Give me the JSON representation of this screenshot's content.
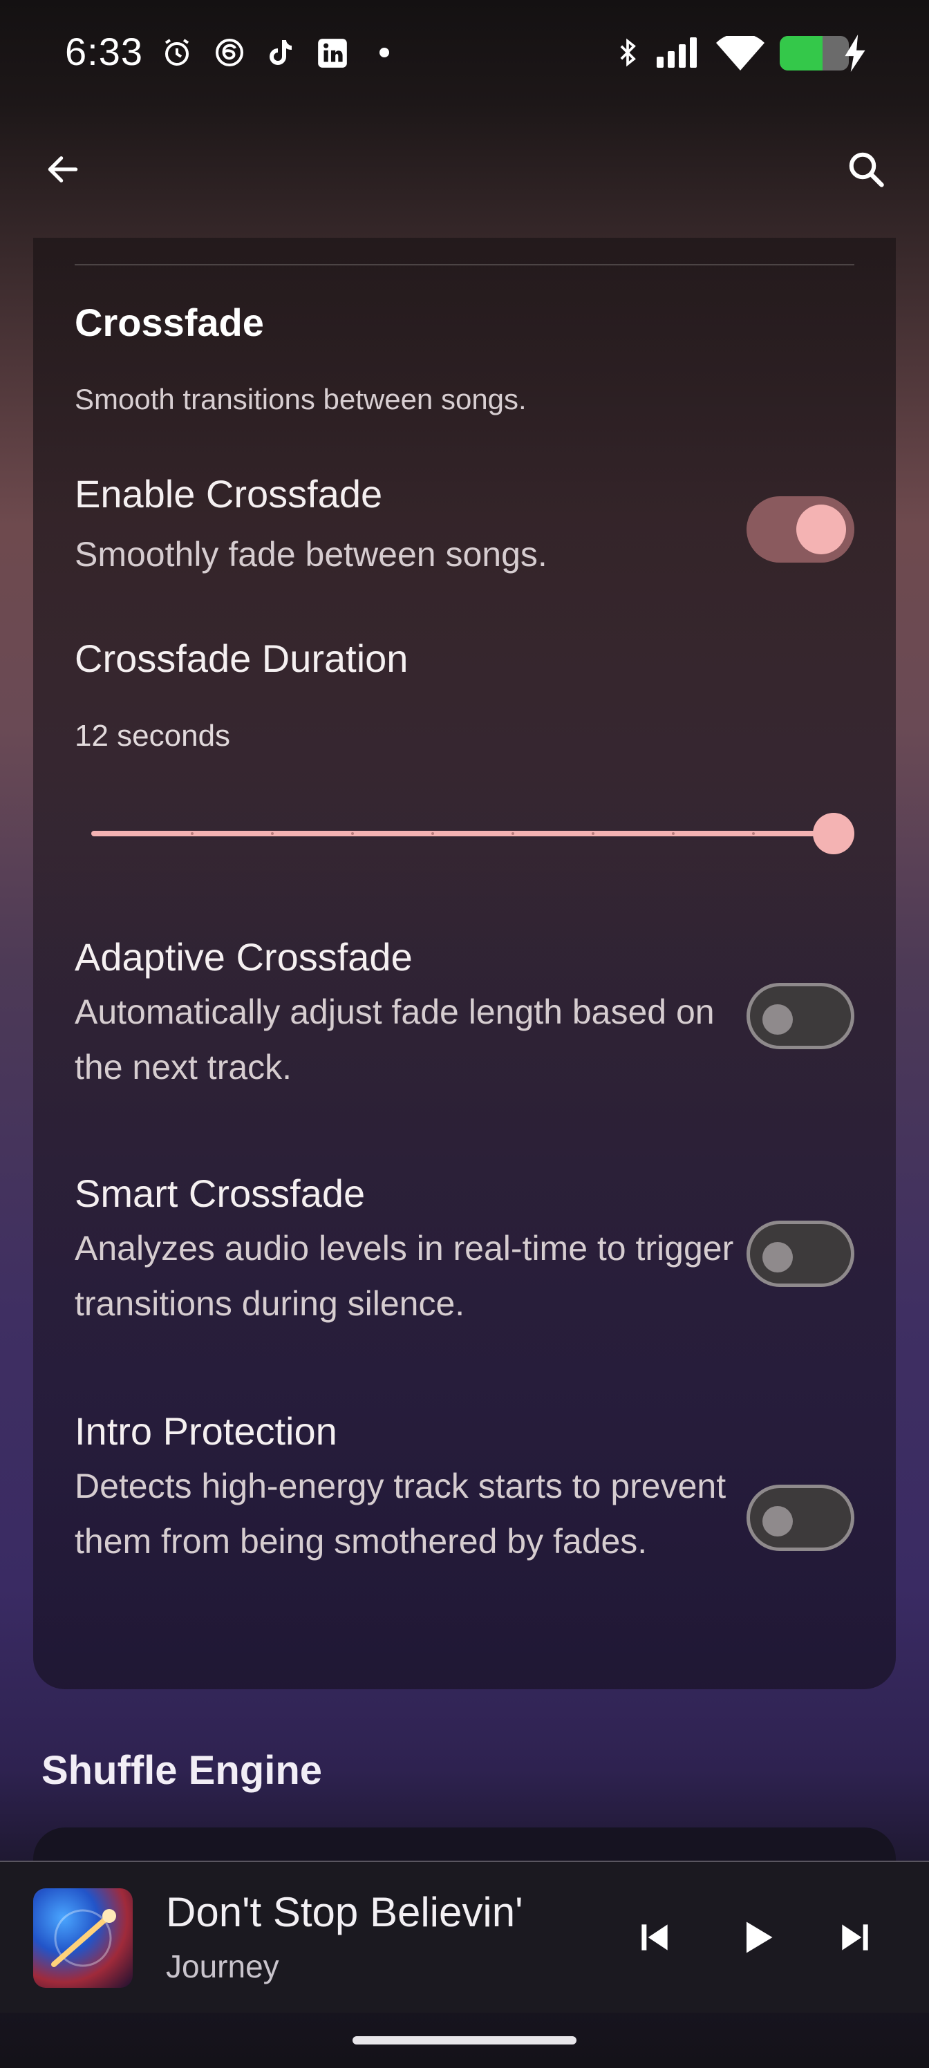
{
  "status_bar": {
    "time": "6:33",
    "battery_level": 0.62,
    "icons": [
      "alarm-icon",
      "threads-icon",
      "tiktok-icon",
      "linkedin-icon",
      "notification-dot-icon",
      "bluetooth-icon",
      "signal-icon",
      "wifi-icon",
      "battery-icon",
      "charging-icon"
    ]
  },
  "app_bar": {
    "back_icon": "arrow-back-icon",
    "search_icon": "search-icon"
  },
  "crossfade": {
    "title": "Crossfade",
    "description": "Smooth transitions between songs.",
    "enable": {
      "title": "Enable Crossfade",
      "description": "Smoothly fade between songs.",
      "enabled": true
    },
    "duration": {
      "title": "Crossfade Duration",
      "value_label": "12 seconds",
      "value": 12,
      "max": 12,
      "steps": 9
    },
    "adaptive": {
      "title": "Adaptive Crossfade",
      "description": "Automatically adjust fade length based on the next track.",
      "enabled": false
    },
    "smart": {
      "title": "Smart Crossfade",
      "description": "Analyzes audio levels in real-time to trigger transitions during silence.",
      "enabled": false
    },
    "intro": {
      "title": "Intro Protection",
      "description": "Detects high-energy track starts to prevent them from being smothered by fades.",
      "enabled": false
    }
  },
  "shuffle_engine": {
    "title": "Shuffle Engine"
  },
  "player": {
    "track_title": "Don't Stop Believin'",
    "artist": "Journey",
    "controls": [
      "skip-previous-icon",
      "play-icon",
      "skip-next-icon"
    ]
  },
  "colors": {
    "accent": "#f4b3b3",
    "switch_on_track": "#8a5a5e",
    "switch_off_track": "#3d3a3b"
  }
}
